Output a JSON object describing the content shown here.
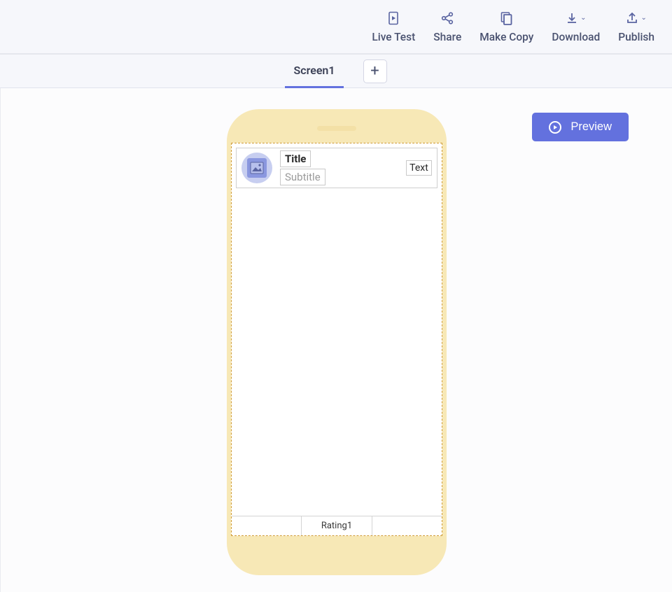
{
  "toolbar": {
    "live_test": "Live Test",
    "share": "Share",
    "make_copy": "Make Copy",
    "download": "Download",
    "publish": "Publish"
  },
  "tabs": {
    "active": "Screen1"
  },
  "preview": {
    "label": "Preview"
  },
  "designer": {
    "list_item": {
      "title": "Title",
      "subtitle": "Subtitle",
      "text": "Text"
    },
    "bottom_nav": {
      "item1": "Rating1"
    }
  },
  "colors": {
    "accent": "#6371de",
    "device_shell": "#f7e8b6"
  }
}
